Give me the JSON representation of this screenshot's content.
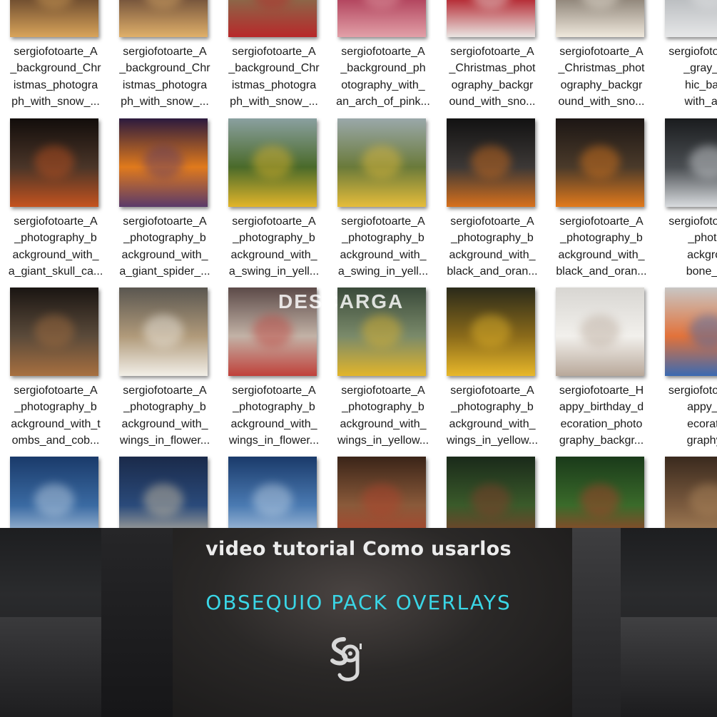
{
  "watermark": "DESCARGA",
  "files": [
    {
      "name": "sergiofotoarte_A\n_background_Chr\nistmas_photogra\nph_with_snow_...",
      "thumb": [
        "#2a1e18",
        "#6b4a2e",
        "#d9a45a"
      ]
    },
    {
      "name": "sergiofotoarte_A\n_background_Chr\nistmas_photogra\nph_with_snow_...",
      "thumb": [
        "#2b2019",
        "#72513a",
        "#e0b06a"
      ]
    },
    {
      "name": "sergiofotoarte_A\n_background_Chr\nistmas_photogra\nph_with_snow_...",
      "thumb": [
        "#d8d4cf",
        "#8a6a4a",
        "#b8282a"
      ]
    },
    {
      "name": "sergiofotoarte_A\n_background_ph\notography_with_\nan_arch_of_pink...",
      "thumb": [
        "#4a1a22",
        "#b0405a",
        "#e2a0a8"
      ]
    },
    {
      "name": "sergiofotoarte_A\n_Christmas_phot\nography_backgr\nound_with_sno...",
      "thumb": [
        "#2a1416",
        "#b3222c",
        "#e9e5e2"
      ]
    },
    {
      "name": "sergiofotoarte_A\n_Christmas_phot\nography_backgr\nound_with_sno...",
      "thumb": [
        "#3a3632",
        "#8c8276",
        "#efe8dc"
      ]
    },
    {
      "name": "sergiofotoarte_A\n_gray_pho\nhic_backg\nwith_a_lar",
      "thumb": [
        "#6a6e72",
        "#b9bcbf",
        "#e6e7e8"
      ]
    },
    {
      "name": "sergiofotoarte_A\n_photography_b\nackground_with_\na_giant_skull_ca...",
      "thumb": [
        "#120d0b",
        "#4a3528",
        "#c5531f"
      ]
    },
    {
      "name": "sergiofotoarte_A\n_photography_b\nackground_with_\na_giant_spider_...",
      "thumb": [
        "#2c1a3e",
        "#e07a1c",
        "#5a3a6a"
      ]
    },
    {
      "name": "sergiofotoarte_A\n_photography_b\nackground_with_\na_swing_in_yell...",
      "thumb": [
        "#8aa0a0",
        "#4a6a2a",
        "#e2b52a"
      ]
    },
    {
      "name": "sergiofotoarte_A\n_photography_b\nackground_with_\na_swing_in_yell...",
      "thumb": [
        "#9aa8aa",
        "#6a7a3a",
        "#e6bd3a"
      ]
    },
    {
      "name": "sergiofotoarte_A\n_photography_b\nackground_with_\nblack_and_oran...",
      "thumb": [
        "#121212",
        "#3c3836",
        "#d8701c"
      ]
    },
    {
      "name": "sergiofotoarte_A\n_photography_b\nackground_with_\nblack_and_oran...",
      "thumb": [
        "#1c1614",
        "#4a3a2a",
        "#e27a1c"
      ]
    },
    {
      "name": "sergiofotoarte_A\n_photogr\nackgroun\nbone_win",
      "thumb": [
        "#1a1c1e",
        "#4a4e52",
        "#d9dcdf"
      ]
    },
    {
      "name": "sergiofotoarte_A\n_photography_b\nackground_with_t\nombs_and_cob...",
      "thumb": [
        "#1a1512",
        "#5a4a3a",
        "#a87040"
      ]
    },
    {
      "name": "sergiofotoarte_A\n_photography_b\nackground_with_\nwings_in_flower...",
      "thumb": [
        "#5a5650",
        "#b09a7a",
        "#f2efe8"
      ]
    },
    {
      "name": "sergiofotoarte_A\n_photography_b\nackground_with_\nwings_in_flower...",
      "thumb": [
        "#5c4a48",
        "#c2b2a6",
        "#c0403a"
      ]
    },
    {
      "name": "sergiofotoarte_A\n_photography_b\nackground_with_\nwings_in_yellow...",
      "thumb": [
        "#3a4a3a",
        "#7a8a6a",
        "#e2b52a"
      ]
    },
    {
      "name": "sergiofotoarte_A\n_photography_b\nackground_with_\nwings_in_yellow...",
      "thumb": [
        "#2a2a1a",
        "#8a6a1a",
        "#e8b82a"
      ]
    },
    {
      "name": "sergiofotoarte_H\nappy_birthday_d\necoration_photo\ngraphy_backgr...",
      "thumb": [
        "#d8d6d2",
        "#f2f0ec",
        "#b8a89a"
      ]
    },
    {
      "name": "sergiofotoarte_H\nappy_birt\necoration\ngraphy_b",
      "thumb": [
        "#c8c6c4",
        "#e2723a",
        "#3a6ab2"
      ]
    },
    {
      "name": "",
      "thumb": [
        "#1a3a6a",
        "#3a6aa2",
        "#c8d8e8"
      ]
    },
    {
      "name": "",
      "thumb": [
        "#1a2a4a",
        "#2a4a7a",
        "#d8c8a8"
      ]
    },
    {
      "name": "",
      "thumb": [
        "#1a3a6a",
        "#4a7ab2",
        "#c8d8e8"
      ]
    },
    {
      "name": "",
      "thumb": [
        "#3a2418",
        "#8a5a3a",
        "#b2402a"
      ]
    },
    {
      "name": "",
      "thumb": [
        "#1a2a1a",
        "#3a5a2a",
        "#8a3a2a"
      ]
    },
    {
      "name": "",
      "thumb": [
        "#1a3a1a",
        "#3a6a2a",
        "#b23a2a"
      ]
    },
    {
      "name": "",
      "thumb": [
        "#3a2a1e",
        "#7a5a3e",
        "#b28a5e"
      ]
    }
  ],
  "banner": {
    "title": "video tutorial  Como usarlos",
    "link": "OBSEQUIO PACK OVERLAYS",
    "link_color": "#3ad6e6",
    "logo_icon": "sg-brand-logo-icon"
  }
}
